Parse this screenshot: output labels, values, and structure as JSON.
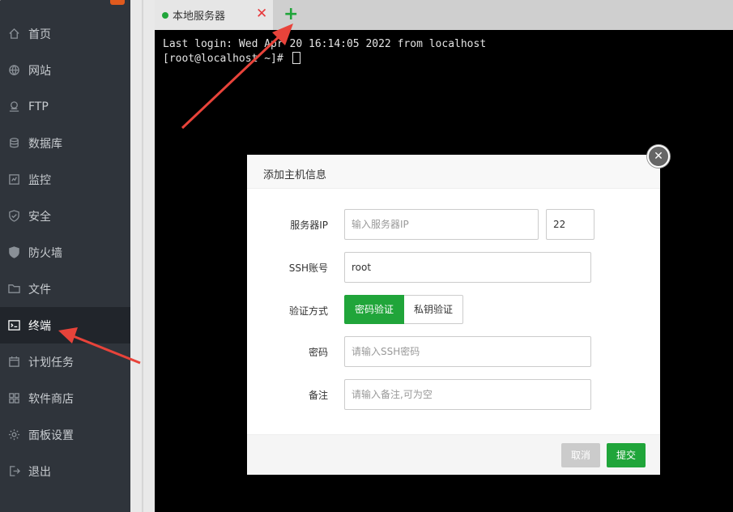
{
  "sidebar": {
    "items": [
      {
        "label": "首页",
        "icon": "home-icon"
      },
      {
        "label": "网站",
        "icon": "globe-icon"
      },
      {
        "label": "FTP",
        "icon": "ftp-icon"
      },
      {
        "label": "数据库",
        "icon": "database-icon"
      },
      {
        "label": "监控",
        "icon": "monitor-icon"
      },
      {
        "label": "安全",
        "icon": "shield-icon"
      },
      {
        "label": "防火墙",
        "icon": "firewall-icon"
      },
      {
        "label": "文件",
        "icon": "folder-icon"
      },
      {
        "label": "终端",
        "icon": "terminal-icon",
        "active": true
      },
      {
        "label": "计划任务",
        "icon": "calendar-icon"
      },
      {
        "label": "软件商店",
        "icon": "apps-icon"
      },
      {
        "label": "面板设置",
        "icon": "gear-icon"
      },
      {
        "label": "退出",
        "icon": "logout-icon"
      }
    ]
  },
  "tabs": {
    "items": [
      {
        "title": "本地服务器",
        "status_color": "#20a53a",
        "close": "✕"
      }
    ],
    "add_label": "+"
  },
  "terminal": {
    "lines": [
      "Last login: Wed Apr 20 16:14:05 2022 from localhost",
      "[root@localhost ~]# "
    ]
  },
  "dialog": {
    "title": "添加主机信息",
    "close": "✕",
    "fields": {
      "server_ip": {
        "label": "服务器IP",
        "placeholder": "输入服务器IP",
        "value": ""
      },
      "port": {
        "value": "22"
      },
      "ssh_account": {
        "label": "SSH账号",
        "value": "root"
      },
      "auth_method": {
        "label": "验证方式",
        "options": [
          "密码验证",
          "私钥验证"
        ],
        "selected": "密码验证"
      },
      "password": {
        "label": "密码",
        "placeholder": "请输入SSH密码",
        "value": ""
      },
      "remark": {
        "label": "备注",
        "placeholder": "请输入备注,可为空",
        "value": ""
      }
    },
    "buttons": {
      "cancel": "取消",
      "submit": "提交"
    }
  },
  "colors": {
    "accent": "#20a53a",
    "danger": "#e8383b",
    "sidebar_bg": "#2f343b",
    "annotation": "#e8433a"
  }
}
